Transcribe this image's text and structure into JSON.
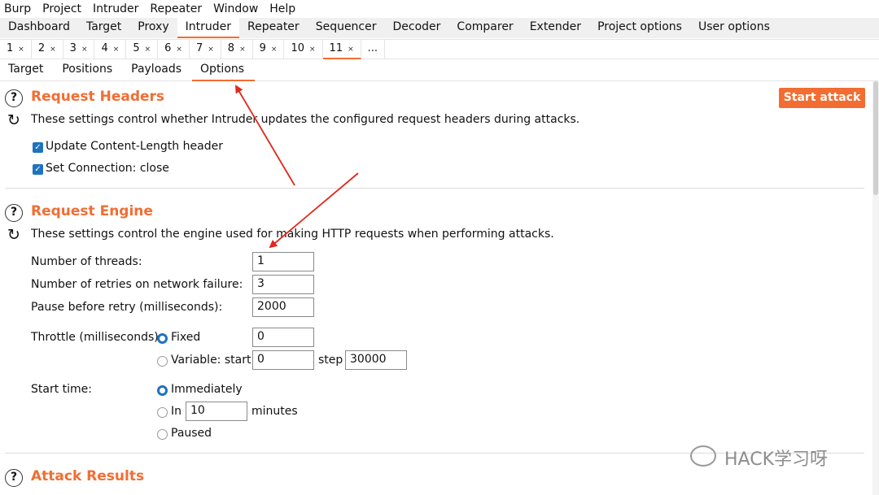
{
  "menu": [
    "Burp",
    "Project",
    "Intruder",
    "Repeater",
    "Window",
    "Help"
  ],
  "main_tabs": [
    "Dashboard",
    "Target",
    "Proxy",
    "Intruder",
    "Repeater",
    "Sequencer",
    "Decoder",
    "Comparer",
    "Extender",
    "Project options",
    "User options"
  ],
  "sub_tabs": [
    "1",
    "2",
    "3",
    "4",
    "5",
    "6",
    "7",
    "8",
    "9",
    "10",
    "11",
    "..."
  ],
  "close_glyph": "×",
  "option_tabs": [
    "Target",
    "Positions",
    "Payloads",
    "Options"
  ],
  "start_attack": "Start attack",
  "request_headers": {
    "title": "Request Headers",
    "description": "These settings control whether Intruder updates the configured request headers during attacks.",
    "update_content_length": "Update Content-Length header",
    "set_connection_close": "Set Connection: close"
  },
  "request_engine": {
    "title": "Request Engine",
    "description": "These settings control the engine used for making HTTP requests when performing attacks.",
    "threads_label": "Number of threads:",
    "threads_value": "1",
    "retries_label": "Number of retries on network failure:",
    "retries_value": "3",
    "pause_label": "Pause before retry (milliseconds):",
    "pause_value": "2000",
    "throttle_label": "Throttle (milliseconds):",
    "fixed_label": "Fixed",
    "fixed_value": "0",
    "variable_label": "Variable:  start",
    "variable_start_value": "0",
    "step_label": "step",
    "step_value": "30000",
    "start_time_label": "Start time:",
    "immediately_label": "Immediately",
    "in_label": "In",
    "in_value": "10",
    "minutes_label": "minutes",
    "paused_label": "Paused"
  },
  "attack_results": {
    "title": "Attack Results"
  },
  "watermark": "HACK学习呀",
  "colors": {
    "accent": "#f26d32",
    "checkbox": "#1e73be",
    "arrow": "#e0281d"
  }
}
